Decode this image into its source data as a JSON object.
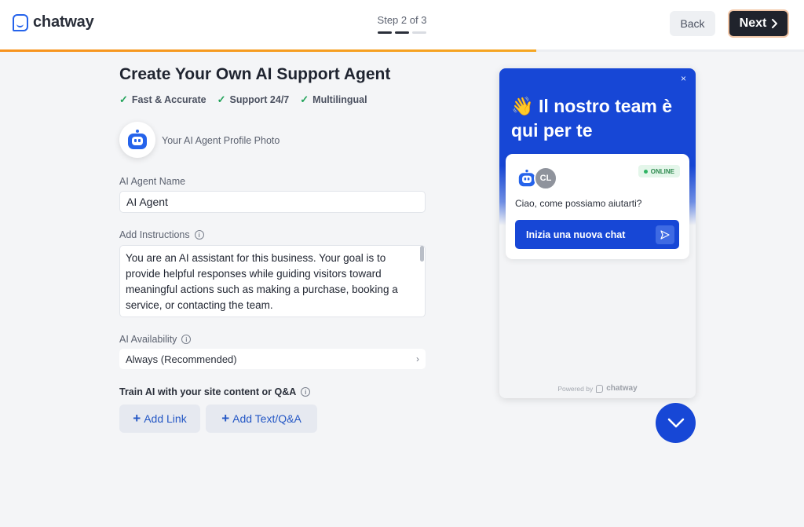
{
  "brand": {
    "name": "chatway"
  },
  "header": {
    "step_label": "Step 2 of 3",
    "step_total": 3,
    "step_current": 2,
    "progress_fraction": 0.667,
    "back_label": "Back",
    "next_label": "Next"
  },
  "form": {
    "title": "Create Your Own AI Support Agent",
    "features": [
      "Fast & Accurate",
      "Support 24/7",
      "Multilingual"
    ],
    "profile_photo_label": "Your AI Agent Profile Photo",
    "name_label": "AI Agent Name",
    "name_value": "AI Agent",
    "instructions_label": "Add Instructions",
    "instructions_value": "You are an AI assistant for this business. Your goal is to provide helpful responses while guiding visitors toward meaningful actions such as making a purchase, booking a service, or contacting the team.",
    "availability_label": "AI Availability",
    "availability_value": "Always (Recommended)",
    "train_label": "Train AI with your site content or Q&A",
    "add_link_label": "Add Link",
    "add_text_label": "Add Text/Q&A"
  },
  "widget": {
    "heading": "👋 Il nostro team è qui per te",
    "close_glyph": "×",
    "agent_initials": "CL",
    "status": "ONLINE",
    "greeting": "Ciao, come possiamo aiutarti?",
    "start_chat_label": "Inizia una nuova chat",
    "powered_by": "Powered by",
    "powered_brand": "chatway"
  },
  "colors": {
    "accent": "#1747d6",
    "progress": "#f7931e",
    "next_button": "#20232c",
    "online": "#2fb463"
  }
}
